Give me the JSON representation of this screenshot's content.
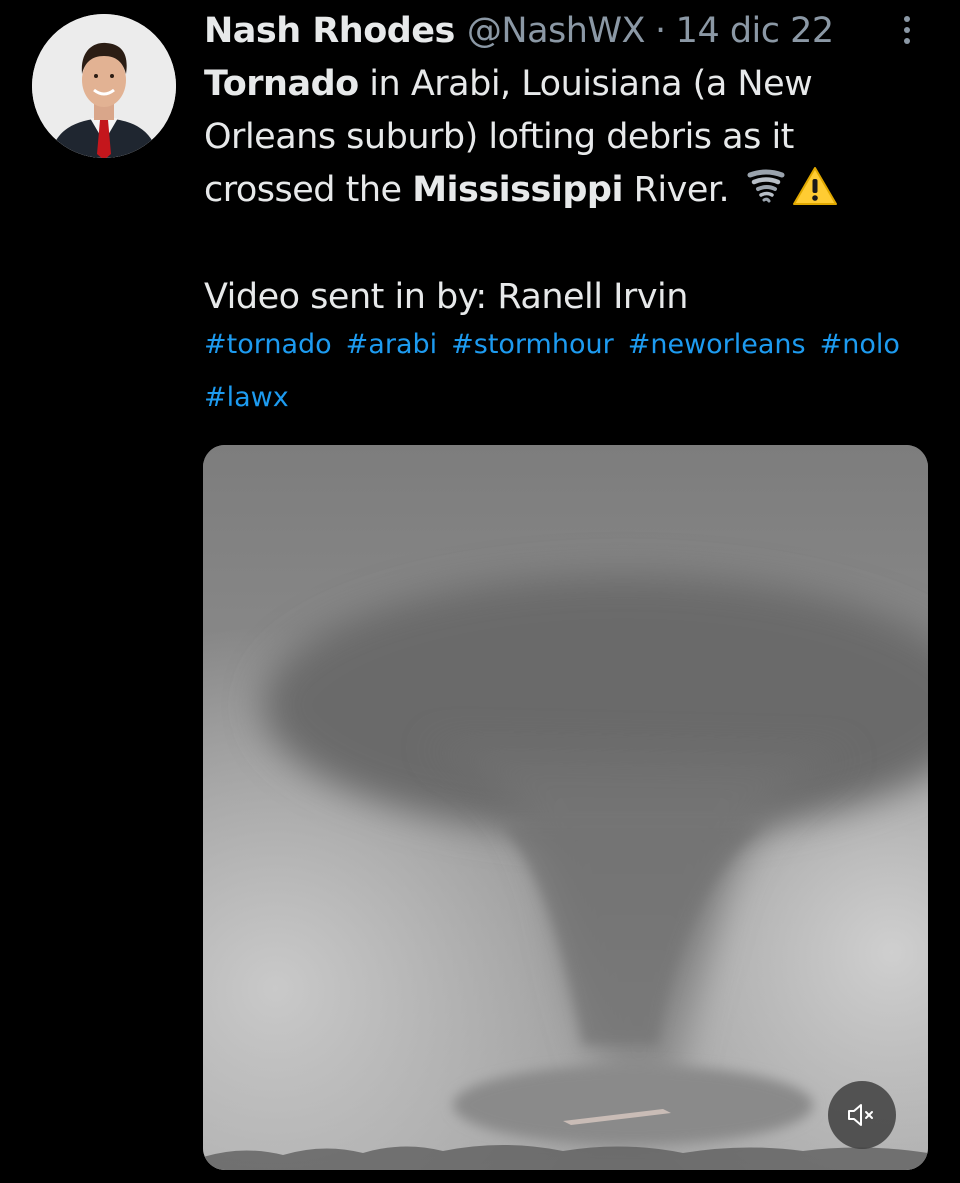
{
  "tweet": {
    "author": {
      "display_name": "Nash Rhodes",
      "handle": "@NashWX",
      "separator": "·",
      "date": "14 dic 22",
      "avatar_icon": "profile-photo"
    },
    "more_icon": "more-vertical-icon",
    "text": {
      "line1_bold": "Tornado",
      "line1_rest": " in Arabi, Louisiana (a New Orleans suburb) lofting debris as it crossed the ",
      "bold_river": "Mississippi",
      "after_river": " River.",
      "emojis": [
        "tornado-emoji",
        "warning-emoji"
      ]
    },
    "credit": "Video sent in by: Ranell Irvin",
    "hashtags": [
      "#tornado",
      "#arabi",
      "#stormhour",
      "#neworleans",
      "#nolo",
      "#lawx"
    ],
    "media": {
      "type": "video",
      "mute_icon": "speaker-muted-icon"
    }
  },
  "colors": {
    "background": "#000000",
    "primary_text": "#e7e9ea",
    "secondary_text": "#8b98a5",
    "link": "#1d9bf0"
  }
}
